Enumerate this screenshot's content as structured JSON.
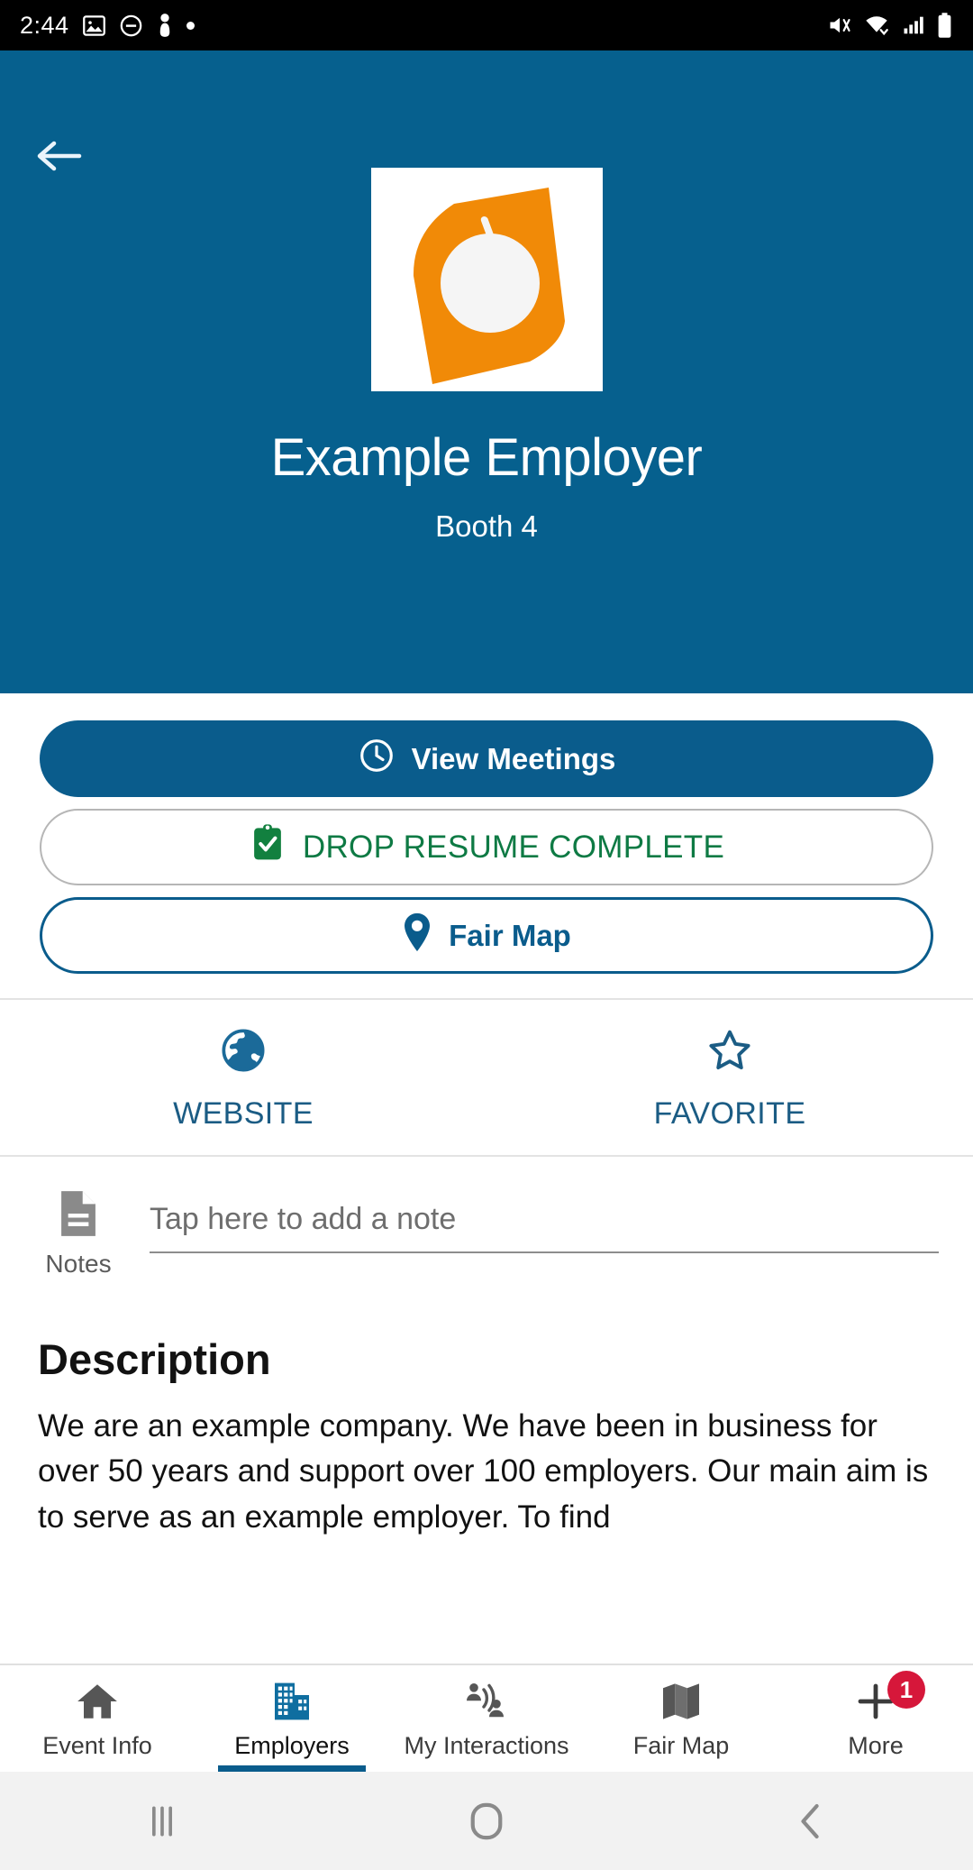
{
  "status_bar": {
    "time": "2:44",
    "left_icons": [
      "image-icon",
      "do-not-disturb-icon",
      "person-icon",
      "dot-indicator"
    ],
    "right_icons": [
      "volume-muted-icon",
      "wifi-icon",
      "cellular-signal-icon",
      "battery-icon"
    ]
  },
  "header": {
    "back_icon": "back-arrow-icon",
    "logo": "employer-logo",
    "title": "Example Employer",
    "booth": "Booth 4",
    "background_color": "#06608E"
  },
  "actions": {
    "view_meetings": {
      "label": "View Meetings",
      "icon": "clock-icon"
    },
    "drop_resume": {
      "label": "DROP RESUME COMPLETE",
      "icon": "clipboard-check-icon",
      "color": "#0E7A44"
    },
    "fair_map": {
      "label": "Fair Map",
      "icon": "map-pin-icon",
      "color": "#0A5C8C"
    }
  },
  "quick_actions": [
    {
      "label": "WEBSITE",
      "icon": "globe-icon"
    },
    {
      "label": "FAVORITE",
      "icon": "star-outline-icon"
    }
  ],
  "notes": {
    "label": "Notes",
    "icon": "document-icon",
    "value": "",
    "placeholder": "Tap here to add a note"
  },
  "description": {
    "heading": "Description",
    "body": "We are an example company. We have been in business for over 50 years and support over 100 employers. Our main aim is to serve as an example employer. To find"
  },
  "tabs": [
    {
      "label": "Event Info",
      "icon": "home-icon",
      "active": false
    },
    {
      "label": "Employers",
      "icon": "building-icon",
      "active": true
    },
    {
      "label": "My Interactions",
      "icon": "interactions-icon",
      "active": false
    },
    {
      "label": "Fair Map",
      "icon": "map-icon",
      "active": false
    },
    {
      "label": "More",
      "icon": "plus-icon",
      "active": false,
      "badge": "1"
    }
  ],
  "android_nav": {
    "recents": "recents-icon",
    "home": "home-button-icon",
    "back": "back-button-icon"
  }
}
